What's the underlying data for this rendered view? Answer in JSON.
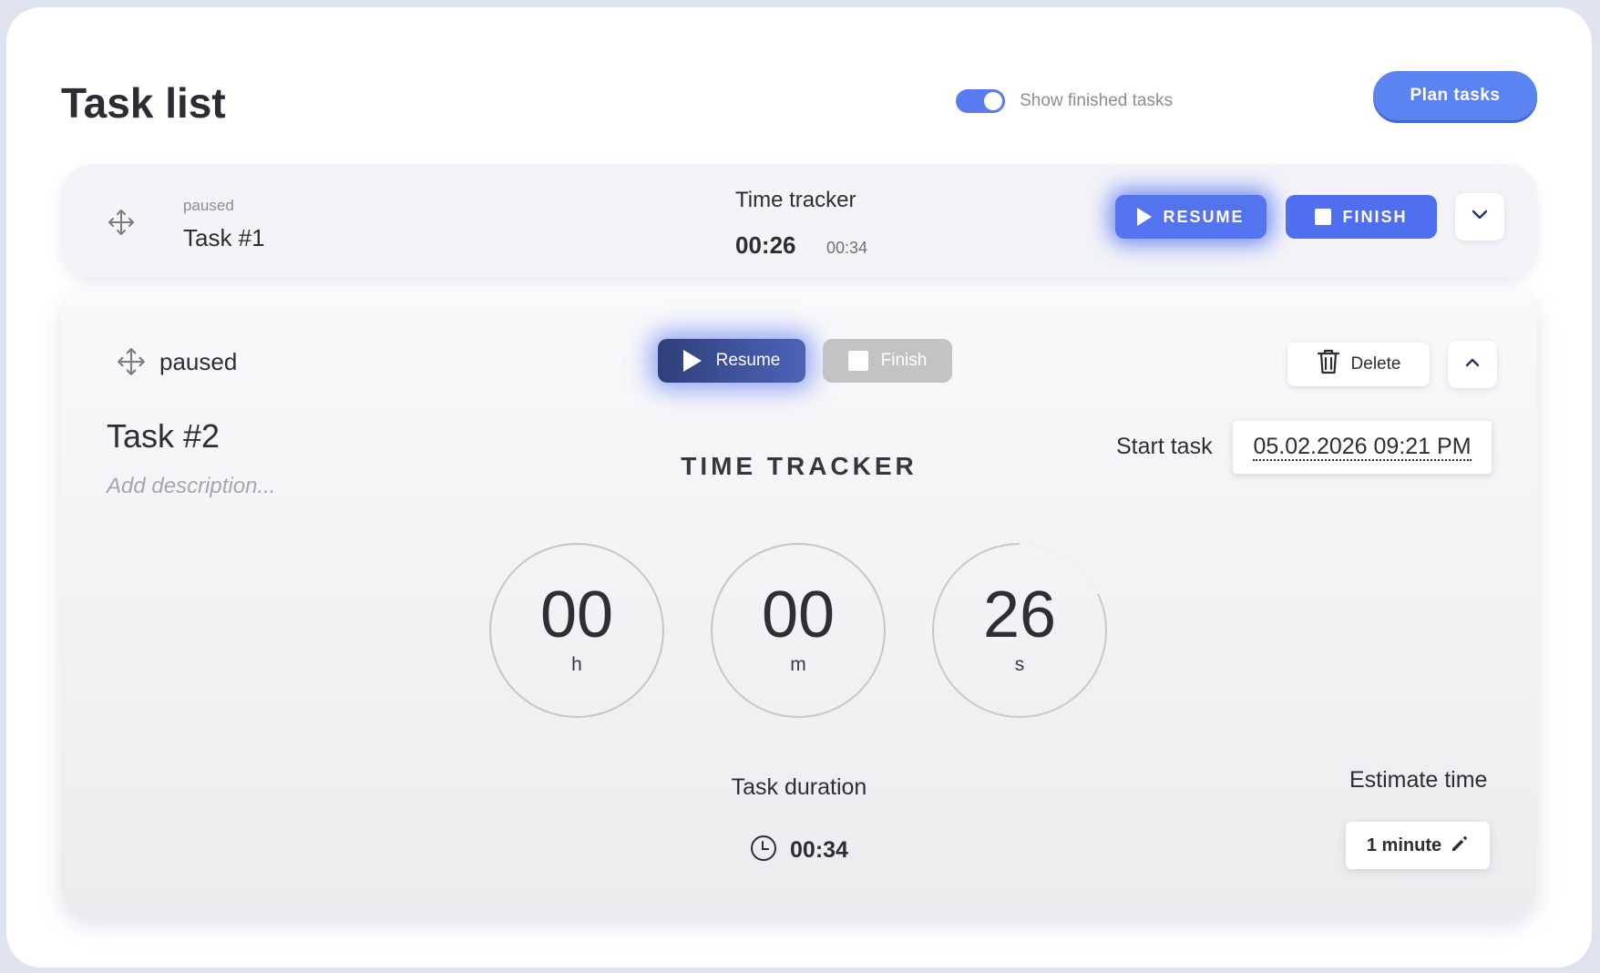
{
  "header": {
    "title": "Task list",
    "toggle_label": "Show finished tasks",
    "toggle_on": true,
    "plan_button": "Plan tasks"
  },
  "tasks": [
    {
      "status": "paused",
      "name": "Task #1",
      "tracker_label": "Time tracker",
      "tracker_time": "00:26",
      "tracker_total": "00:34",
      "resume_label": "RESUME",
      "finish_label": "FINISH",
      "expand_icon": "chevron-down-icon"
    },
    {
      "status": "paused",
      "name": "Task #2",
      "description_placeholder": "Add description...",
      "resume_label": "Resume",
      "finish_label": "Finish",
      "delete_label": "Delete",
      "collapse_icon": "chevron-up-icon",
      "tracker_heading": "TIME TRACKER",
      "start_label": "Start task",
      "start_value": "05.02.2026 09:21 PM",
      "timer": {
        "hours": "00",
        "hours_unit": "h",
        "minutes": "00",
        "minutes_unit": "m",
        "seconds": "26",
        "seconds_unit": "s"
      },
      "duration_label": "Task duration",
      "duration_value": "00:34",
      "estimate_label": "Estimate time",
      "estimate_value": "1 minute"
    }
  ],
  "colors": {
    "accent": "#5473ee",
    "resume_dark": "#2f3f7a",
    "finish_disabled": "#c3c3c6"
  }
}
